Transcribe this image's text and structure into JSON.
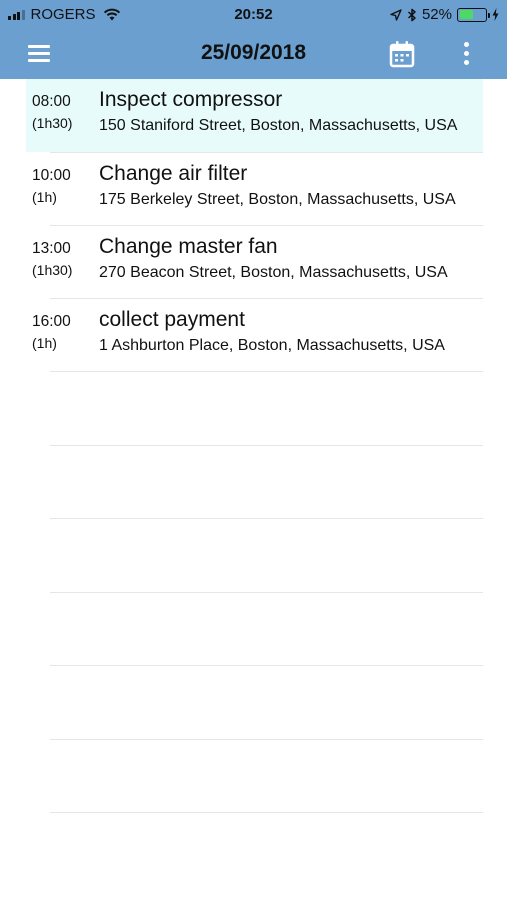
{
  "status_bar": {
    "carrier": "ROGERS",
    "time": "20:52",
    "battery_percent": "52%",
    "battery_level": 0.52,
    "battery_color": "#4cd964"
  },
  "nav": {
    "title": "25/09/2018",
    "background": "#6b9fd0",
    "menu_icon": "hamburger-menu-icon",
    "calendar_icon": "calendar-icon",
    "more_icon": "more-vertical-icon"
  },
  "events": [
    {
      "time": "08:00",
      "duration": "(1h30)",
      "title": "Inspect compressor",
      "address": "150 Staniford Street, Boston, Massachusetts, USA",
      "selected": true
    },
    {
      "time": "10:00",
      "duration": "(1h)",
      "title": "Change air filter",
      "address": "175 Berkeley Street, Boston, Massachusetts, USA",
      "selected": false
    },
    {
      "time": "13:00",
      "duration": "(1h30)",
      "title": "Change master fan",
      "address": "270 Beacon Street, Boston, Massachusetts, USA",
      "selected": false
    },
    {
      "time": "16:00",
      "duration": "(1h)",
      "title": "collect payment",
      "address": "1 Ashburton Place, Boston, Massachusetts, USA",
      "selected": false
    }
  ],
  "selected_row_color": "#e8fbfb"
}
